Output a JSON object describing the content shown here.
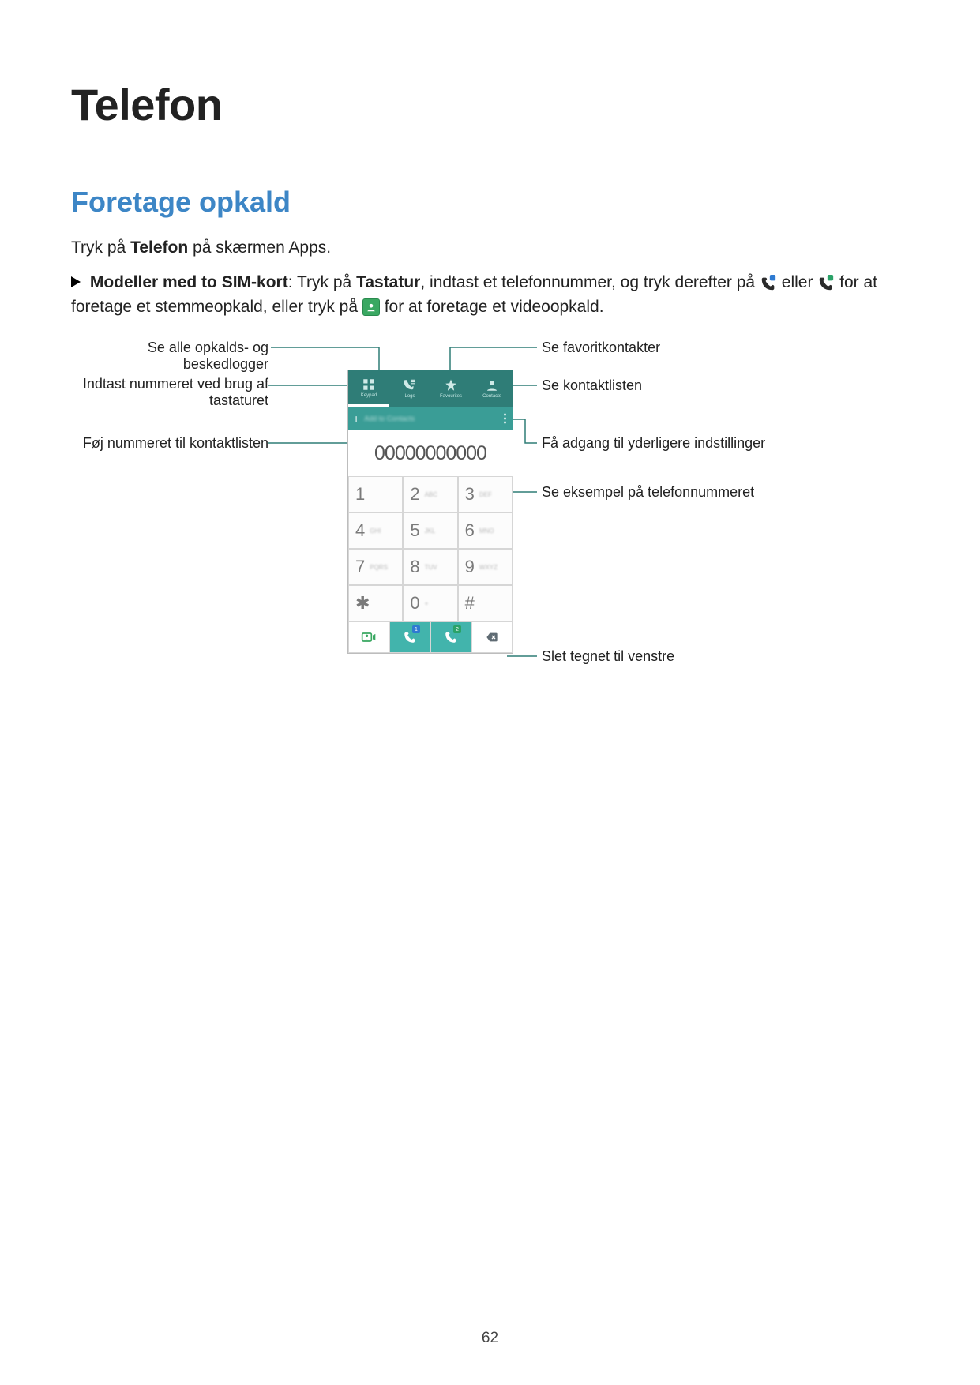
{
  "page_number": "62",
  "title": "Telefon",
  "section_heading": "Foretage opkald",
  "para1_a": "Tryk på ",
  "para1_b": "Telefon",
  "para1_c": " på skærmen Apps.",
  "para2_a": "Modeller med to SIM-kort",
  "para2_b": ": Tryk på ",
  "para2_c": "Tastatur",
  "para2_d": ", indtast et telefonnummer, og tryk derefter på ",
  "para2_e": " eller ",
  "para2_f": " for at foretage et stemmeopkald, eller tryk på ",
  "para2_g": " for at foretage et videoopkald.",
  "annotations": {
    "log": "Se alle opkalds- og beskedlogger",
    "keypad": "Indtast nummeret ved brug af tastaturet",
    "add_contact": "Føj nummeret til kontaktlisten",
    "favourites": "Se favoritkontakter",
    "contacts": "Se kontaktlisten",
    "options": "Få adgang til yderligere indstillinger",
    "preview": "Se eksempel på telefonnummeret",
    "backspace": "Slet tegnet til venstre"
  },
  "dialer": {
    "add_to_contacts_label": "Add to Contacts",
    "number": "00000000000",
    "tabs": [
      "Keypad",
      "Logs",
      "Favourites",
      "Contacts"
    ],
    "keys": [
      {
        "d": "1",
        "s": ""
      },
      {
        "d": "2",
        "s": "ABC"
      },
      {
        "d": "3",
        "s": "DEF"
      },
      {
        "d": "4",
        "s": "GHI"
      },
      {
        "d": "5",
        "s": "JKL"
      },
      {
        "d": "6",
        "s": "MNO"
      },
      {
        "d": "7",
        "s": "PQRS"
      },
      {
        "d": "8",
        "s": "TUV"
      },
      {
        "d": "9",
        "s": "WXYZ"
      },
      {
        "d": "✱",
        "s": ""
      },
      {
        "d": "0",
        "s": "+"
      },
      {
        "d": "#",
        "s": ""
      }
    ],
    "sim_badges": [
      "1",
      "2"
    ]
  }
}
